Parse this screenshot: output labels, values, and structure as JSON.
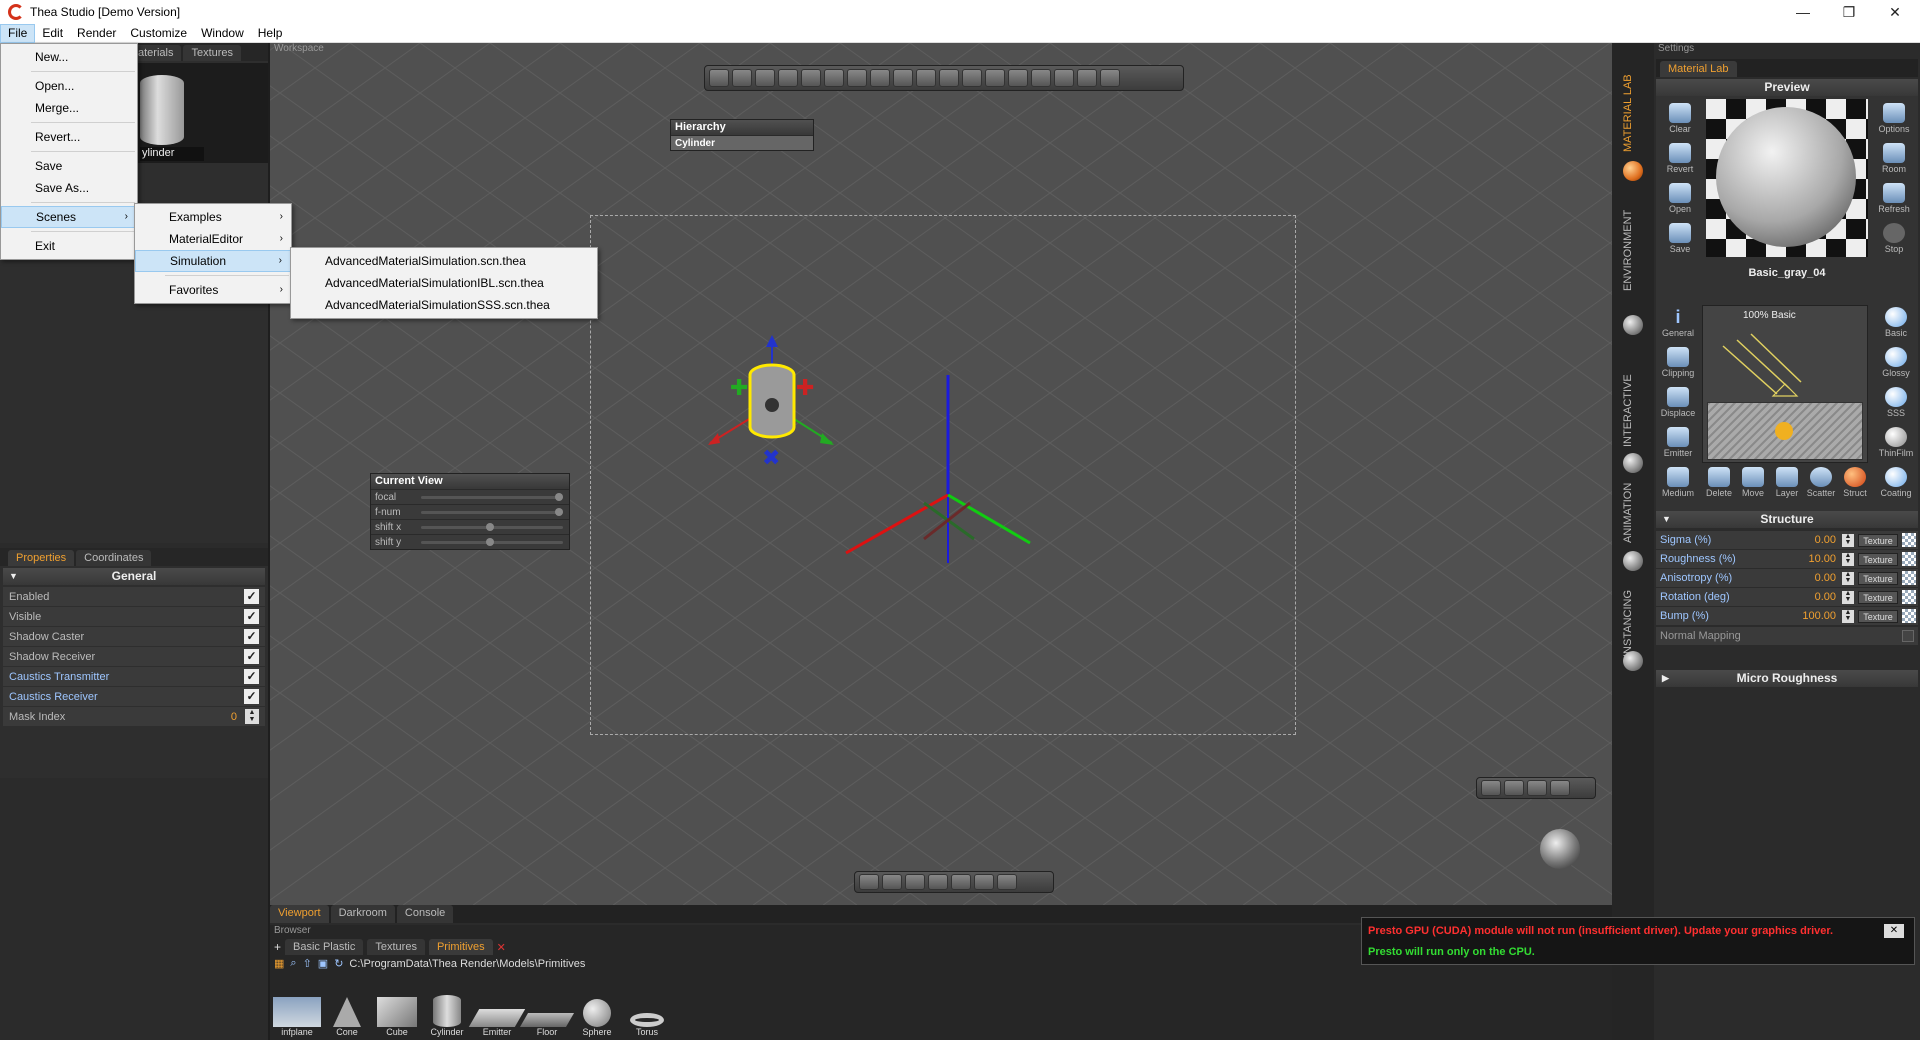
{
  "window": {
    "title": "Thea Studio [Demo Version]",
    "minimize": "—",
    "maximize": "❐",
    "close": "✕"
  },
  "menubar": [
    "File",
    "Edit",
    "Render",
    "Customize",
    "Window",
    "Help"
  ],
  "file_menu": {
    "items": [
      "New...",
      "Open...",
      "Merge...",
      "Revert...",
      "Save",
      "Save As...",
      "Scenes",
      "Exit"
    ]
  },
  "scenes_menu": {
    "items": [
      "Examples",
      "MaterialEditor",
      "Simulation",
      "Favorites"
    ]
  },
  "simulation_menu": {
    "items": [
      "AdvancedMaterialSimulation.scn.thea",
      "AdvancedMaterialSimulationIBL.scn.thea",
      "AdvancedMaterialSimulationSSS.scn.thea"
    ]
  },
  "left": {
    "tabs": [
      "aterials",
      "Textures"
    ],
    "object_label": "ylinder",
    "props_tabs": [
      "Properties",
      "Coordinates"
    ],
    "general_header": "General",
    "rows": [
      {
        "label": "Enabled",
        "checked": true,
        "hl": false
      },
      {
        "label": "Visible",
        "checked": true,
        "hl": false
      },
      {
        "label": "Shadow Caster",
        "checked": true,
        "hl": false
      },
      {
        "label": "Shadow Receiver",
        "checked": true,
        "hl": false
      },
      {
        "label": "Caustics Transmitter",
        "checked": true,
        "hl": true
      },
      {
        "label": "Caustics Receiver",
        "checked": true,
        "hl": true
      }
    ],
    "mask_label": "Mask Index",
    "mask_value": "0"
  },
  "viewport": {
    "label": "Workspace",
    "hierarchy_title": "Hierarchy",
    "hierarchy_item": "Cylinder",
    "current_view_title": "Current View",
    "current_view_rows": [
      "focal",
      "f-num",
      "shift x",
      "shift y"
    ]
  },
  "right": {
    "label": "Settings",
    "vtabs": [
      "MATERIAL LAB",
      "ENVIRONMENT",
      "INTERACTIVE",
      "ANIMATION",
      "INSTANCING"
    ],
    "material_tab": "Material Lab",
    "preview_title": "Preview",
    "preview_left": [
      "Clear",
      "Revert",
      "Open",
      "Save"
    ],
    "preview_right": [
      "Options",
      "Room",
      "Refresh",
      "Stop"
    ],
    "material_name": "Basic_gray_04",
    "layer_label": "100% Basic",
    "left_buttons": [
      "General",
      "Clipping",
      "Displace",
      "Emitter",
      "Medium"
    ],
    "right_buttons": [
      "Basic",
      "Glossy",
      "SSS",
      "ThinFilm",
      "Coating"
    ],
    "bottom_buttons": [
      "Delete",
      "Move",
      "Layer",
      "Scatter",
      "Struct"
    ],
    "structure_title": "Structure",
    "structure_rows": [
      {
        "label": "Sigma (%)",
        "value": "0.00"
      },
      {
        "label": "Roughness (%)",
        "value": "10.00"
      },
      {
        "label": "Anisotropy (%)",
        "value": "0.00"
      },
      {
        "label": "Rotation (deg)",
        "value": "0.00"
      },
      {
        "label": "Bump (%)",
        "value": "100.00"
      }
    ],
    "texture_label": "Texture",
    "normal_mapping": "Normal Mapping",
    "micro_roughness": "Micro Roughness"
  },
  "bottom": {
    "tabs": [
      "Viewport",
      "Darkroom",
      "Console"
    ],
    "browser_label": "Browser",
    "browser_tabs": [
      "Basic Plastic",
      "Textures",
      "Primitives"
    ],
    "path": "C:\\ProgramData\\Thea Render\\Models\\Primitives",
    "primitives": [
      "infplane",
      "Cone",
      "Cube",
      "Cylinder",
      "Emitter",
      "Floor",
      "Sphere",
      "Torus"
    ]
  },
  "gpu": {
    "line1": "Presto GPU (CUDA) module will not run (insufficient driver). Update your graphics driver.",
    "line2": "Presto will run only on the CPU.",
    "close": "✕"
  }
}
